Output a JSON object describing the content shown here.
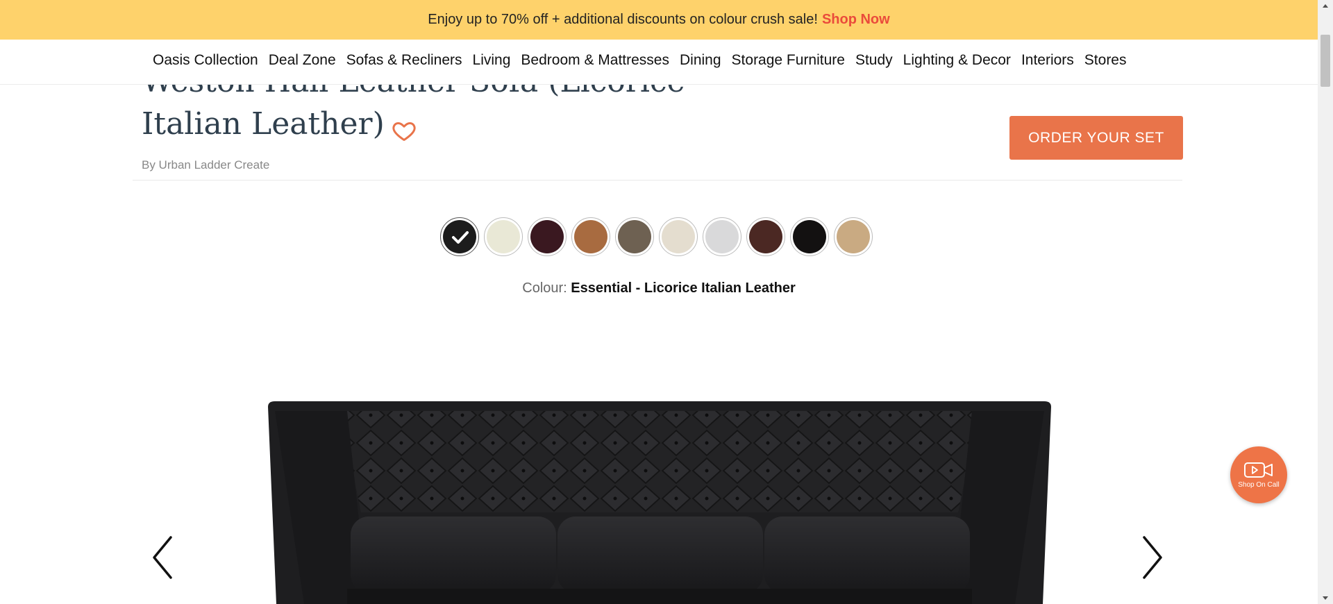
{
  "promo": {
    "text": "Enjoy up to 70% off + additional discounts on colour crush sale!",
    "cta": "Shop Now"
  },
  "nav": {
    "items": [
      {
        "label": "Oasis Collection"
      },
      {
        "label": "Deal Zone"
      },
      {
        "label": "Sofas & Recliners"
      },
      {
        "label": "Living"
      },
      {
        "label": "Bedroom & Mattresses"
      },
      {
        "label": "Dining"
      },
      {
        "label": "Storage Furniture"
      },
      {
        "label": "Study"
      },
      {
        "label": "Lighting & Decor"
      },
      {
        "label": "Interiors"
      },
      {
        "label": "Stores"
      }
    ]
  },
  "product": {
    "title": "Weston Hall Leather Sofa (Licorice Italian Leather)",
    "brand": "By Urban Ladder Create",
    "order_button": "ORDER YOUR SET",
    "colour_label": "Colour:",
    "colour_value": "Essential - Licorice Italian Leather"
  },
  "swatches": [
    {
      "color": "#1c1c1c",
      "selected": true
    },
    {
      "color": "#e9e8d6",
      "selected": false
    },
    {
      "color": "#3a1820",
      "selected": false
    },
    {
      "color": "#a86b40",
      "selected": false
    },
    {
      "color": "#6e6152",
      "selected": false
    },
    {
      "color": "#e4ddcf",
      "selected": false
    },
    {
      "color": "#d9d9da",
      "selected": false
    },
    {
      "color": "#4b2823",
      "selected": false
    },
    {
      "color": "#131111",
      "selected": false
    },
    {
      "color": "#c9aa82",
      "selected": false
    }
  ],
  "video_call": {
    "label": "Shop On Call"
  },
  "colors": {
    "promo_bg": "#fed26b",
    "accent": "#e9744a",
    "cta_red": "#ea4b3b",
    "title": "#2f3f4d"
  }
}
